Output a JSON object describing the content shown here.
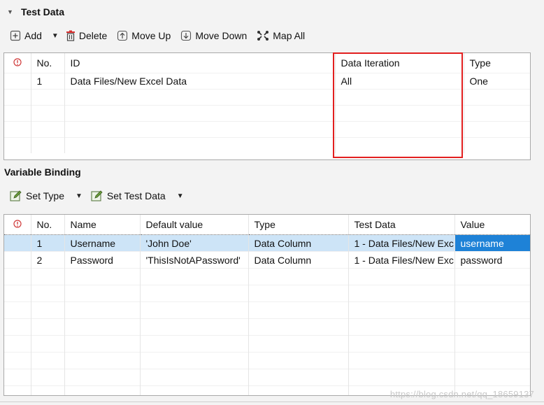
{
  "test_data": {
    "title": "Test Data",
    "toolbar": {
      "add": "Add",
      "delete": "Delete",
      "move_up": "Move Up",
      "move_down": "Move Down",
      "map_all": "Map All"
    },
    "columns": [
      "No.",
      "ID",
      "Data Iteration",
      "Type"
    ],
    "rows": [
      {
        "no": "1",
        "id": "Data Files/New Excel Data",
        "iteration": "All",
        "type": "One"
      }
    ],
    "highlight_color": "#e21f1f"
  },
  "variable_binding": {
    "title": "Variable Binding",
    "toolbar": {
      "set_type": "Set Type",
      "set_test_data": "Set Test Data"
    },
    "columns": [
      "No.",
      "Name",
      "Default value",
      "Type",
      "Test Data",
      "Value"
    ],
    "rows": [
      {
        "no": "1",
        "name": "Username",
        "default": "'John Doe'",
        "type": "Data Column",
        "test_data": "1 - Data Files/New Exc",
        "value": "username"
      },
      {
        "no": "2",
        "name": "Password",
        "default": "'ThisIsNotAPassword'",
        "type": "Data Column",
        "test_data": "1 - Data Files/New Exc",
        "value": "password"
      }
    ],
    "selected_color": "#1e82d7"
  },
  "watermark": "https://blog.csdn.net/qq_18659137"
}
